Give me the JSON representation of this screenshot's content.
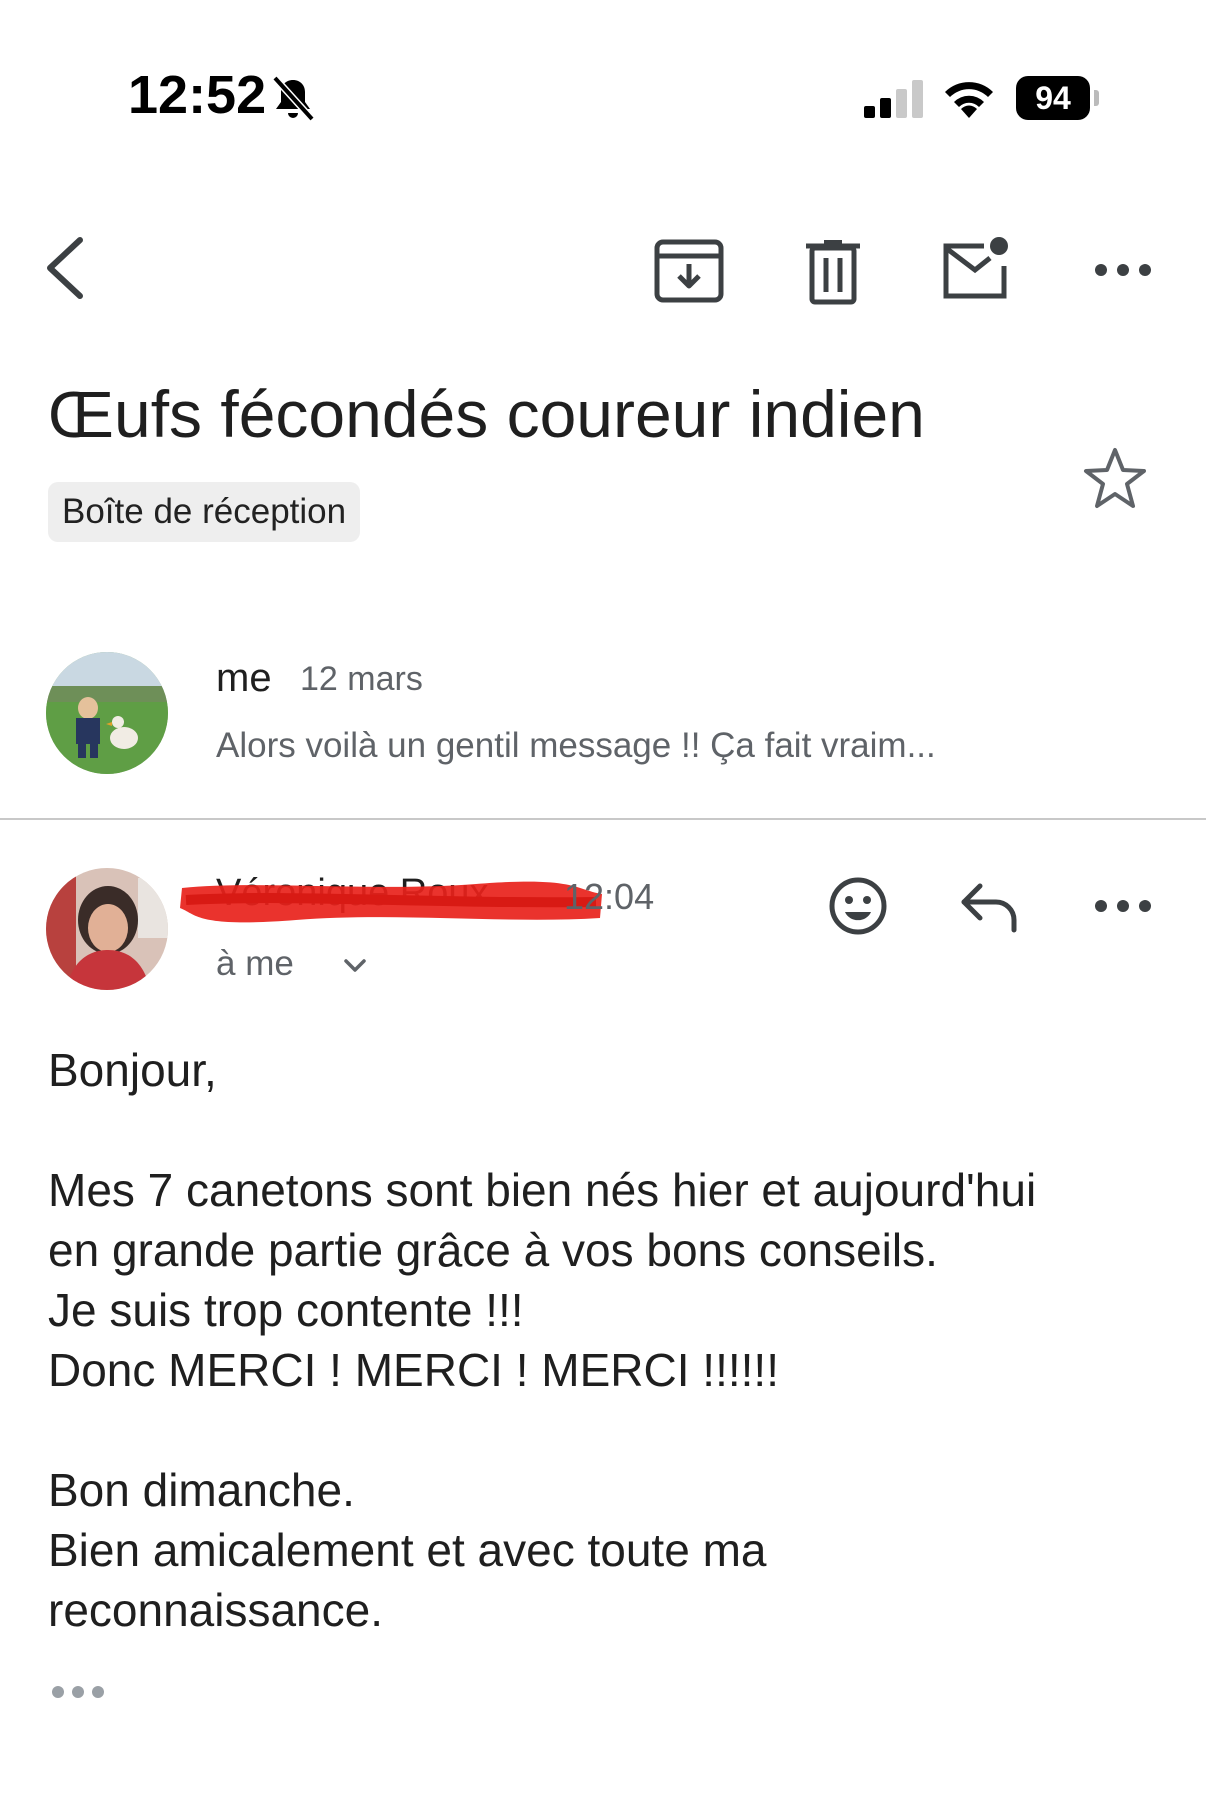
{
  "status_bar": {
    "time": "12:52",
    "battery": "94",
    "icons": [
      "bell-slash-icon",
      "signal-icon",
      "wifi-icon",
      "battery-icon"
    ]
  },
  "toolbar": {
    "icons": [
      "back-icon",
      "archive-icon",
      "trash-icon",
      "mark-unread-icon",
      "more-icon"
    ]
  },
  "thread": {
    "subject": "Œufs fécondés coureur indien",
    "label": "Boîte de réception",
    "star_icon": "star-outline-icon"
  },
  "messages": [
    {
      "sender": "me",
      "date": "12 mars",
      "snippet": "Alors voilà un gentil message !! Ça fait vraim..."
    },
    {
      "sender": "Véronique Roux",
      "time": "12:04",
      "to": "à me",
      "body": {
        "greeting": "Bonjour,",
        "p1": [
          "Mes 7 canetons sont bien nés hier et aujourd'hui",
          "en grande partie grâce à vos bons conseils.",
          "Je suis trop contente !!!",
          "Donc MERCI ! MERCI ! MERCI !!!!!!"
        ],
        "p2": [
          "Bon dimanche.",
          "Bien amicalement et avec toute ma",
          "reconnaissance."
        ]
      }
    }
  ],
  "colors": {
    "text": "#1f1f1f",
    "secondary": "#5f6368",
    "chip_bg": "#eeeeee",
    "redaction": "#e8221b"
  }
}
